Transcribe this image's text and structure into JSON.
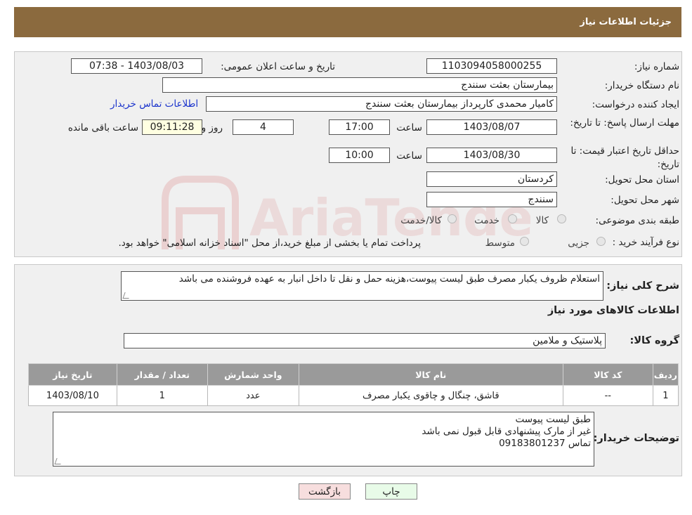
{
  "header": {
    "title": "جزئیات اطلاعات نیاز"
  },
  "form": {
    "need_number_label": "شماره نیاز:",
    "need_number": "1103094058000255",
    "announce_label": "تاریخ و ساعت اعلان عمومی:",
    "announce_value": "1403/08/03 - 07:38",
    "buyer_org_label": "نام دستگاه خریدار:",
    "buyer_org": "بیمارستان بعثت سنندج",
    "creator_label": "ایجاد کننده درخواست:",
    "creator": "کامیار محمدی کارپرداز بیمارستان بعثت سنندج",
    "contact_link": "اطلاعات تماس خریدار",
    "deadline_label": "مهلت ارسال پاسخ: تا تاریخ:",
    "deadline_date": "1403/08/07",
    "time_label": "ساعت",
    "deadline_time": "17:00",
    "days_value": "4",
    "days_label": "روز و",
    "remaining_time": "09:11:28",
    "remaining_label": "ساعت باقی مانده",
    "validity_label": "حداقل تاریخ اعتبار قیمت: تا تاریخ:",
    "validity_date": "1403/08/30",
    "validity_time": "10:00",
    "province_label": "استان محل تحویل:",
    "province": "کردستان",
    "city_label": "شهر محل تحویل:",
    "city": "سنندج",
    "category_label": "طبقه بندی موضوعی:",
    "category_options": [
      "کالا",
      "خدمت",
      "کالا/خدمت"
    ],
    "process_label": "نوع فرآیند خرید :",
    "process_options": [
      "جزیی",
      "متوسط"
    ],
    "process_note": "پرداخت تمام یا بخشی از مبلغ خرید،از محل \"اسناد خزانه اسلامی\" خواهد بود."
  },
  "details": {
    "summary_label": "شرح کلی نیاز:",
    "summary": "استعلام ظروف یکبار مصرف طبق لیست پیوست،هزینه حمل و نقل  تا داخل انبار به عهده فروشنده  می باشد",
    "goods_info_title": "اطلاعات کالاهای مورد نیاز",
    "goods_group_label": "گروه کالا:",
    "goods_group": "پلاستیک و ملامین",
    "table": {
      "headers": [
        "ردیف",
        "کد کالا",
        "نام کالا",
        "واحد شمارش",
        "تعداد / مقدار",
        "تاریخ نیاز"
      ],
      "rows": [
        [
          "1",
          "--",
          "قاشق، چنگال و چاقوی یکبار مصرف",
          "عدد",
          "1",
          "1403/08/10"
        ]
      ]
    },
    "buyer_notes_label": "توضیحات خریدار:",
    "buyer_notes": [
      "طبق لیست پیوست",
      "غیر از مارک پیشنهادی قابل قبول نمی باشد",
      "تماس 09183801237"
    ]
  },
  "buttons": {
    "print": "چاپ",
    "back": "بازگشت"
  },
  "colors": {
    "header": "#8b6a3e",
    "link": "#1a33cc",
    "table_header": "#9a9a9a",
    "back_button": "#f7dede",
    "print_button": "#e8fbe8"
  }
}
